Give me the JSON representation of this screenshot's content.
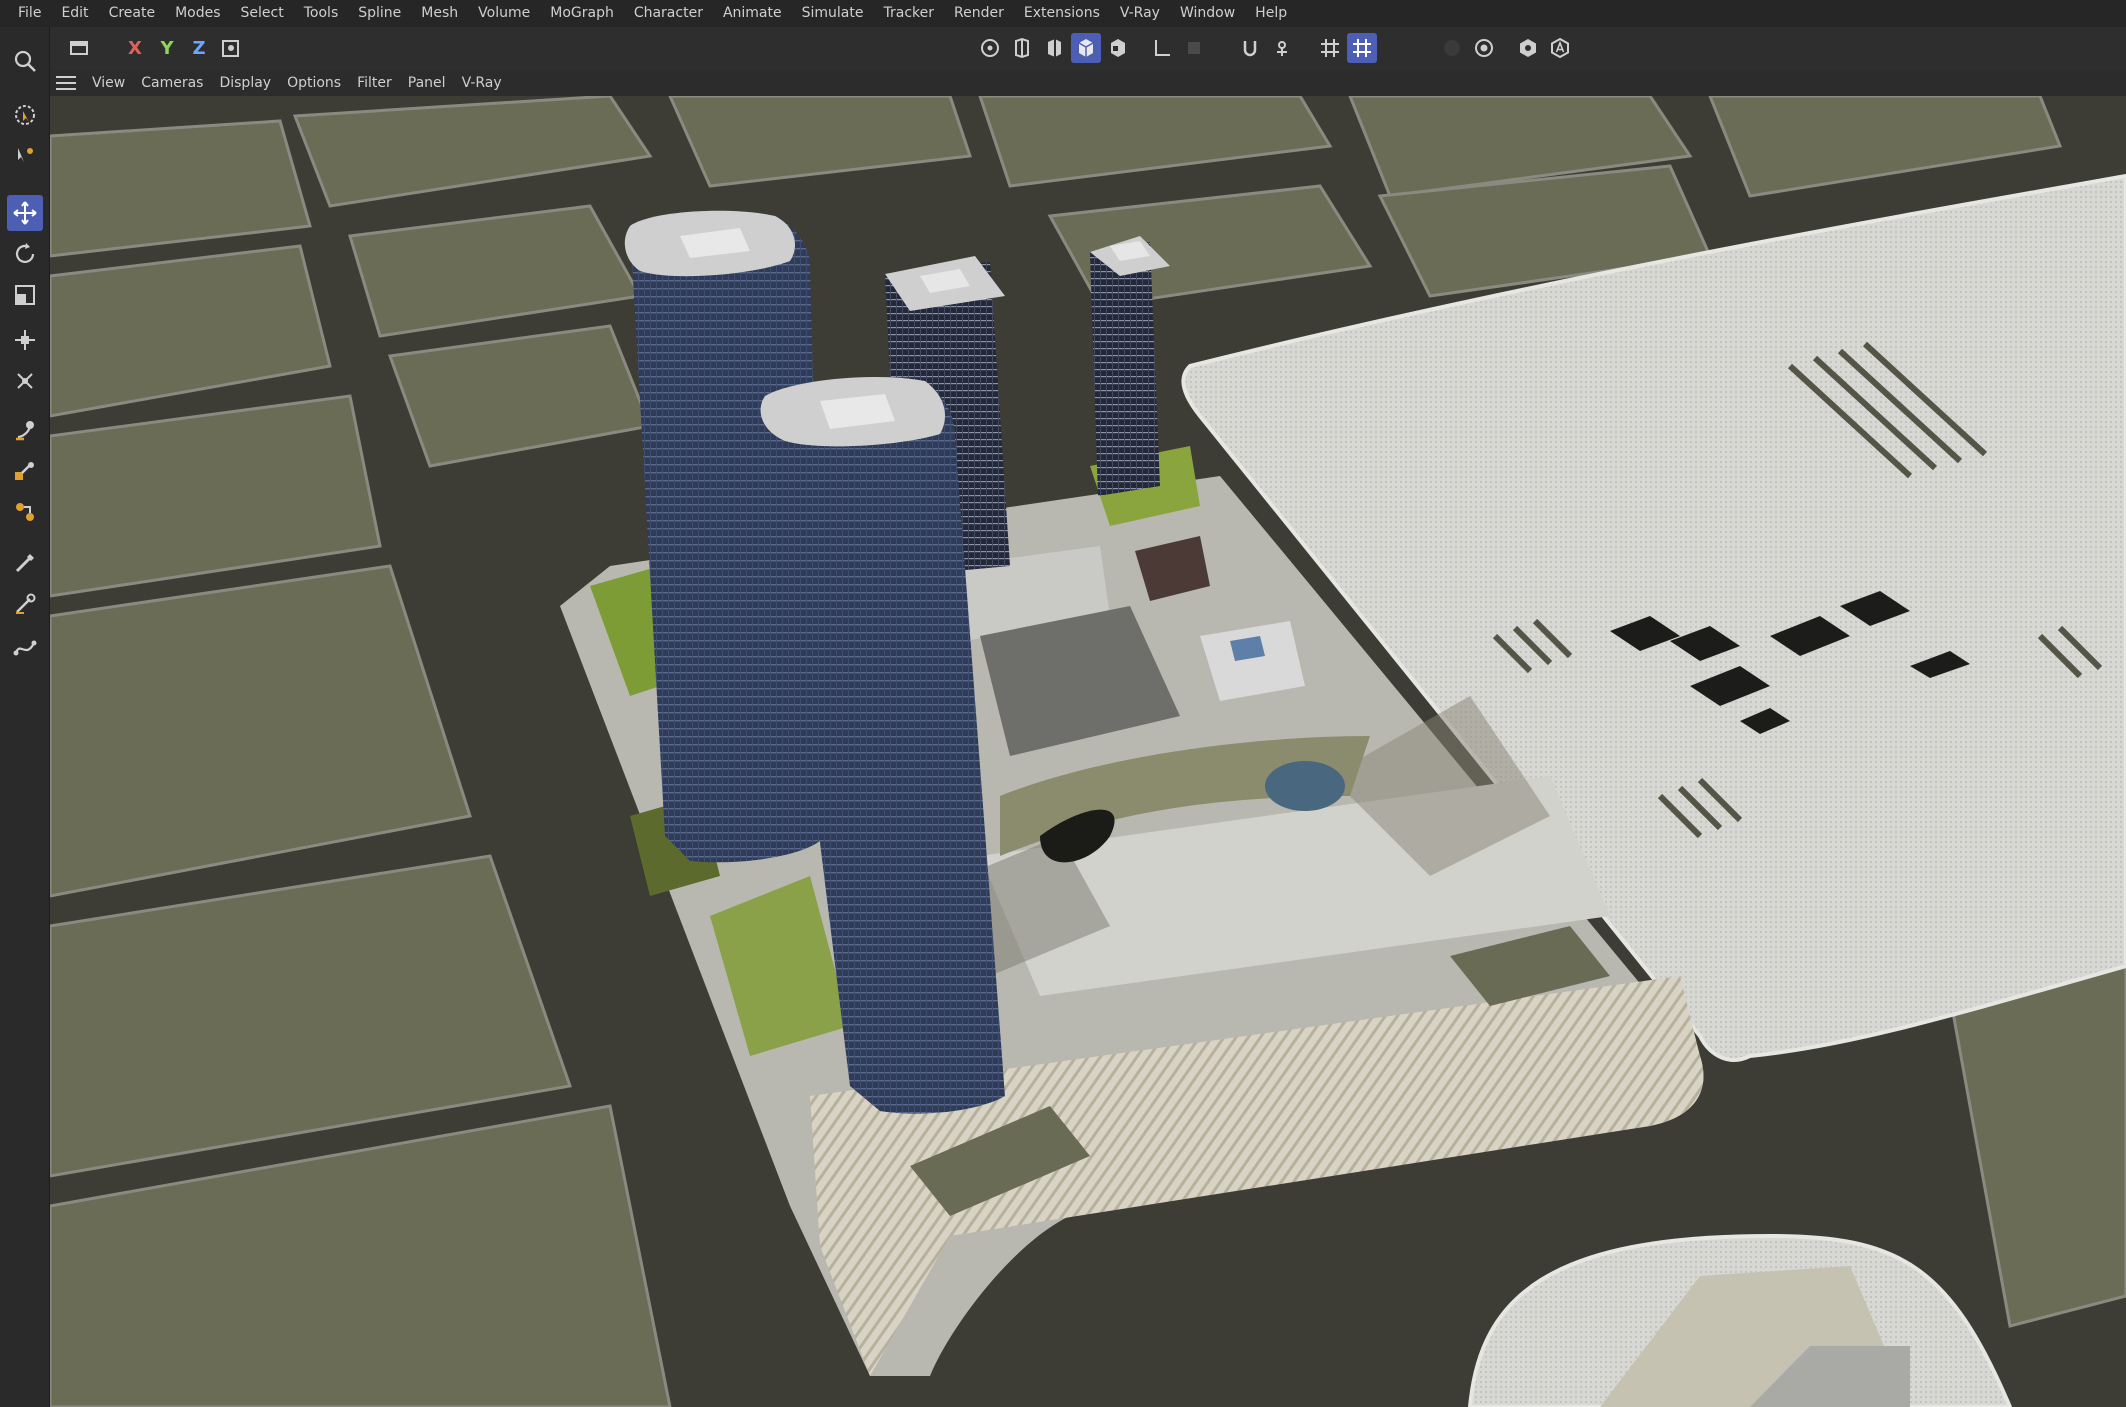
{
  "menubar": {
    "items": [
      "File",
      "Edit",
      "Create",
      "Modes",
      "Select",
      "Tools",
      "Spline",
      "Mesh",
      "Volume",
      "MoGraph",
      "Character",
      "Animate",
      "Simulate",
      "Tracker",
      "Render",
      "Extensions",
      "V-Ray",
      "Window",
      "Help"
    ]
  },
  "toolbar": {
    "axis_x": "X",
    "axis_y": "Y",
    "axis_z": "Z",
    "icons": [
      "undo-view-icon",
      "lock-x-icon",
      "lock-y-icon",
      "lock-z-icon",
      "coordinate-system-icon",
      "points-mode-icon",
      "edges-mode-icon",
      "polygons-mode-icon",
      "model-mode-icon",
      "texture-mode-icon",
      "axis-mode-icon",
      "solo-icon",
      "snap-enable-icon",
      "snap-settings-icon",
      "grid-icon",
      "workplane-icon",
      "render-region-icon",
      "render-view-icon",
      "render-settings-icon",
      "vray-icon"
    ],
    "accent": "#4d5fb5"
  },
  "left_toolbar": {
    "icons": [
      "search-icon",
      "live-selection-icon",
      "move-selection-icon",
      "move-icon",
      "rotate-icon",
      "scale-icon",
      "transfer-icon",
      "placement-icon",
      "magnet-icon",
      "bend-icon",
      "dynamics-icon",
      "brush-icon",
      "knife-icon",
      "spline-pen-icon"
    ]
  },
  "viewport_menu": {
    "items": [
      "View",
      "Cameras",
      "Display",
      "Options",
      "Filter",
      "Panel",
      "V-Ray"
    ]
  },
  "viewport": {
    "colors": {
      "ground": "#6a6b55",
      "road": "#3c3c34",
      "plaza": "#c8c8c2",
      "tower_glass": "#2d3a55",
      "tower_light": "#3b4a6a",
      "roof": "#d0d0d0",
      "green_roof": "#7e9e3a"
    }
  }
}
